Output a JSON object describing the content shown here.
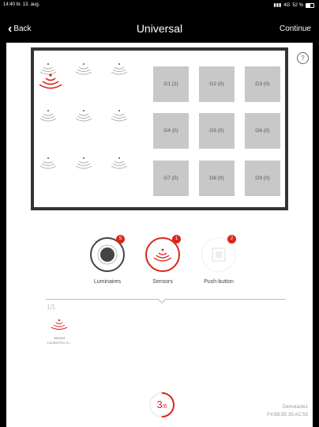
{
  "status_bar": {
    "time": "14:40",
    "date": "tir. 13. aug.",
    "signal": "4G",
    "battery": "52 %"
  },
  "nav": {
    "back_label": "Back",
    "title": "Universal",
    "continue_label": "Continue"
  },
  "help_label": "?",
  "groups": [
    "G1 (2)",
    "G2 (0)",
    "G3 (0)",
    "G4 (0)",
    "G5 (0)",
    "G6 (0)",
    "G7 (0)",
    "G8 (0)",
    "G9 (0)"
  ],
  "actions": [
    {
      "label": "Luminaires",
      "count": "5"
    },
    {
      "label": "Sensors",
      "count": "1"
    },
    {
      "label": "Push-button",
      "count": "2"
    }
  ],
  "pager": "1/1",
  "device": {
    "line1": "Steinel",
    "line2": "Control Pro H..."
  },
  "progress": {
    "current": "3",
    "total": "/6"
  },
  "device_info": {
    "name": "Demotavle1",
    "mac": "F4:B8:5E:35:AC:53"
  },
  "colors": {
    "accent": "#d9261c",
    "group_tile": "#c8c8c8",
    "frame": "#333333"
  }
}
